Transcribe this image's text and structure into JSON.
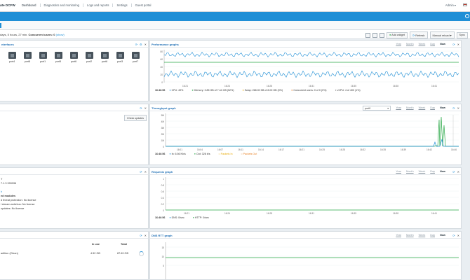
{
  "nav": {
    "brand": "ate DCFW",
    "items": [
      "Dashboard",
      "Diagnostics and monitoring",
      "Logs and reports",
      "Settings",
      "Guest portal"
    ],
    "user": "Admin ▾"
  },
  "status": {
    "uptime_text": "days, 5 hours, 27 min.",
    "concurrent_label": "Concurrent users:",
    "concurrent_value": "0",
    "show_label": "(show)"
  },
  "toolbar": {
    "add_widget": "Add widget",
    "refresh": "Refresh",
    "manual_reload": "Manual reload ▾",
    "sync": "Sync"
  },
  "range_labels": [
    "Year",
    "Month",
    "Week",
    "Day",
    "Now"
  ],
  "interfaces": {
    "title": "nterfaces",
    "ports": [
      "port4",
      "port8",
      "port1",
      "port5",
      "port6",
      "port2",
      "port6",
      "port3",
      "port7"
    ]
  },
  "performance": {
    "title": "Performance graphs",
    "timestamp": "16:46:56",
    "y_ticks": [
      "80",
      "60",
      "40",
      "20",
      "0"
    ],
    "x_ticks": [
      "16:21",
      "16:24",
      "16:28",
      "16:31",
      "16:35",
      "16:38",
      "16:41"
    ],
    "legend": [
      {
        "text": "CPU: 49%",
        "color": "#1f8fd6"
      },
      {
        "text": "Memory: 3.85 GB of 7.44 GB (52%)",
        "color": "#27a745"
      },
      {
        "text": "Swap: 268.00 KB of 8.00 GB (0%)",
        "color": "#e6a700"
      },
      {
        "text": "Concurrent users: 0 of 0 (0%)",
        "color": "#e67e22"
      },
      {
        "text": "vCPU: 4 of 400 (1%)",
        "color": "#888888"
      }
    ]
  },
  "updates": {
    "check_label": "Check updates"
  },
  "throughput": {
    "title": "Throughput graph",
    "select_value": "port0",
    "timestamp": "16:46:56",
    "y_ticks": [
      "5M",
      "4M",
      "3M",
      "2M",
      "1M",
      "0"
    ],
    "x_ticks": [
      "16:01",
      "16:04",
      "16:07",
      "16:11",
      "16:14",
      "16:17",
      "16:21",
      "16:25",
      "16:28",
      "16:32",
      "16:35",
      "16:39",
      "16:42",
      "16:46"
    ],
    "legend": [
      {
        "text": "In: 6.56 Kb/s",
        "color": "#1f8fd6"
      },
      {
        "text": "Out: 328 b/s",
        "color": "#27a745"
      },
      {
        "text": "Packets In",
        "color": "#e6a700"
      },
      {
        "text": "Packets Out",
        "color": "#e67e22"
      }
    ]
  },
  "requests": {
    "title": "Requests graph",
    "timestamp": "16:46:56",
    "y_ticks": [
      "1",
      "0.8",
      "0.6",
      "0.4",
      "0.2",
      "0"
    ],
    "x_ticks": [
      "16:21",
      "16:24",
      "16:28",
      "16:31",
      "16:35",
      "16:38",
      "16:41"
    ],
    "legend": [
      {
        "text": "DNS: 0/sec",
        "color": "#1f8fd6"
      },
      {
        "text": "HTTP: 0/sec",
        "color": "#27a745"
      }
    ]
  },
  "sysinfo": {
    "line1": "T",
    "line2": "7.1.3 999996",
    "line3": "h",
    "modules_heading": "ed modules",
    "mod1": "d threat protection: No license",
    "mod2": "l stream antivirus: No license",
    "mod3": "updates: No license"
  },
  "disks": {
    "col_in_use": "In use",
    "col_total": "Total",
    "row_name": "artition (Clean)",
    "row_in_use": "4.52 GB",
    "row_total": "87.69 GB"
  },
  "dns": {
    "title": "DNS RTT graph",
    "y_ticks": [
      "15",
      "10",
      "5"
    ]
  }
}
